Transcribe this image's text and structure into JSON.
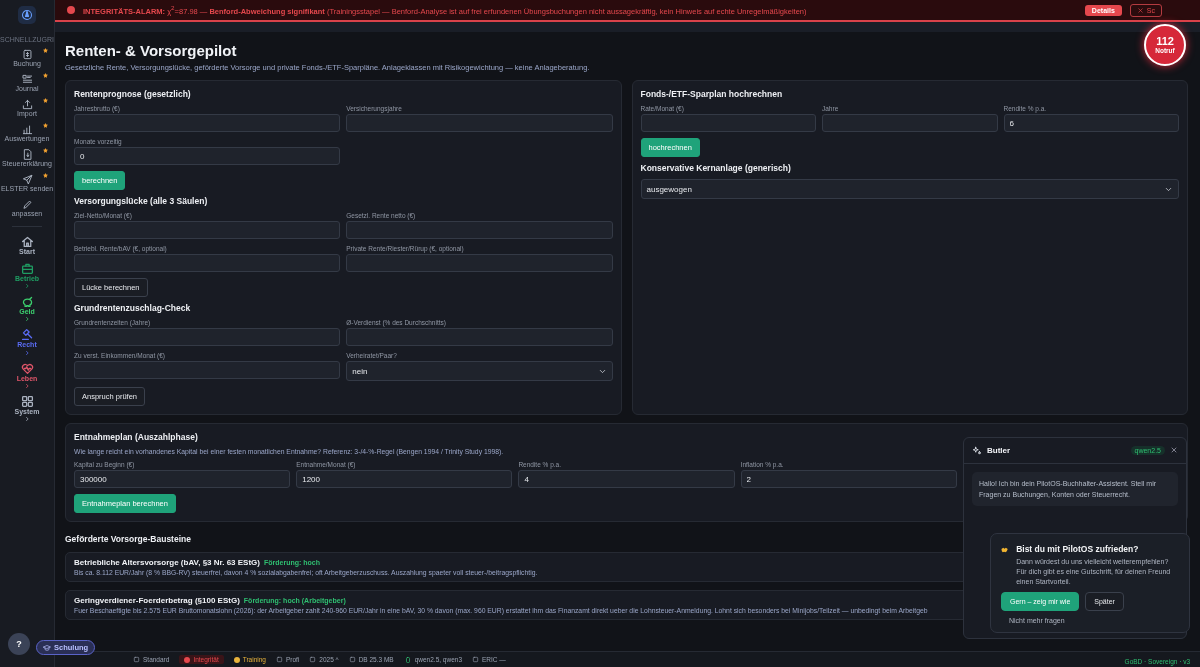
{
  "alarm": {
    "text": "**INTEGRITÄTS-ALARM:** χ$^{2}$=87.98 — **Benford-Abweichung signifikant** (Trainingsstapel — Benford-Analyse ist auf frei erfundenen Übungsbuchungen nicht aussagekräftig, kein Hinweis auf echte Unregelmäßigkeiten)",
    "details": "Details",
    "close": "Sc"
  },
  "emergency": {
    "number": "112",
    "label": "Notruf"
  },
  "sidebar": {
    "quick_label": "SCHNELLZUGRI",
    "quick_items": [
      {
        "label": "Buchung",
        "starred": true
      },
      {
        "label": "Journal",
        "starred": true
      },
      {
        "label": "Import",
        "starred": true
      },
      {
        "label": "Auswertungen",
        "starred": true
      },
      {
        "label": "Steuererklärung",
        "starred": true
      },
      {
        "label": "ELSTER senden",
        "starred": true
      },
      {
        "label": "anpassen",
        "starred": false
      }
    ],
    "sections": [
      {
        "label": "Start",
        "color": "#aab2c0",
        "expandable": false
      },
      {
        "label": "Betrieb",
        "color": "#1f9d63",
        "expandable": true
      },
      {
        "label": "Geld",
        "color": "#3ccf6e",
        "expandable": true
      },
      {
        "label": "Recht",
        "color": "#5a6cf5",
        "expandable": true
      },
      {
        "label": "Leben",
        "color": "#e0566a",
        "expandable": true
      },
      {
        "label": "System",
        "color": "#aab2c0",
        "expandable": true
      }
    ]
  },
  "page": {
    "title": "Renten- & Vorsorgepilot",
    "subtitle": "Gesetzliche Rente, Versorgungslücke, geförderte Vorsorge und private Fonds-/ETF-Sparpläne. Anlageklassen mit Risikogewichtung — keine Anlageberatung."
  },
  "left_card": [
    {
      "title": "Rentenprognose (gesetzlich)",
      "rows": [
        [
          {
            "label": "Jahresbrutto (€)",
            "kind": "input"
          },
          {
            "label": "Versicherungsjahre",
            "kind": "input"
          }
        ],
        [
          {
            "label": "Monate vorzeitig",
            "value": "0",
            "kind": "input"
          },
          {
            "kind": "spacer"
          }
        ]
      ],
      "button": {
        "label": "berechnen",
        "kind": "primary"
      }
    },
    {
      "title": "Versorgungslücke (alle 3 Säulen)",
      "rows": [
        [
          {
            "label": "Ziel-Netto/Monat (€)",
            "kind": "input"
          },
          {
            "label": "Gesetzl. Rente netto (€)",
            "kind": "input"
          }
        ],
        [
          {
            "label": "Betriebl. Rente/bAV (€, optional)",
            "kind": "input"
          },
          {
            "label": "Private Rente/Riester/Rürup (€, optional)",
            "kind": "input"
          }
        ]
      ],
      "button": {
        "label": "Lücke berechnen",
        "kind": "outline"
      }
    },
    {
      "title": "Grundrentenzuschlag-Check",
      "rows": [
        [
          {
            "label": "Grundrentenzeiten (Jahre)",
            "kind": "input"
          },
          {
            "label": "Ø-Verdienst (% des Durchschnitts)",
            "kind": "input"
          }
        ],
        [
          {
            "label": "Zu verst. Einkommen/Monat (€)",
            "kind": "input"
          },
          {
            "label": "Verheiratet/Paar?",
            "value": "nein",
            "kind": "select"
          }
        ]
      ],
      "button": {
        "label": "Anspruch prüfen",
        "kind": "outline"
      }
    }
  ],
  "right_card": [
    {
      "title": "Fonds-/ETF-Sparplan hochrechnen",
      "rows": [
        [
          {
            "label": "Rate/Monat (€)",
            "kind": "input"
          },
          {
            "label": "Jahre",
            "kind": "input"
          },
          {
            "label": "Rendite % p.a.",
            "value": "6",
            "kind": "input"
          }
        ]
      ],
      "button": {
        "label": "hochrechnen",
        "kind": "primary"
      }
    },
    {
      "title": "Konservative Kernanlage (generisch)",
      "rows": [
        [
          {
            "value": "ausgewogen",
            "kind": "select"
          }
        ]
      ]
    }
  ],
  "withdrawal": {
    "title": "Entnahmeplan (Auszahlphase)",
    "description": "Wie lange reicht ein vorhandenes Kapital bei einer festen monatlichen Entnahme? Referenz: 3-/4-%-Regel (Bengen 1994 / Trinity Study 1998).",
    "fields": [
      {
        "label": "Kapital zu Beginn (€)",
        "value": "300000",
        "kind": "input"
      },
      {
        "label": "Entnahme/Monat (€)",
        "value": "1200",
        "kind": "input"
      },
      {
        "label": "Rendite % p.a.",
        "value": "4",
        "kind": "input"
      },
      {
        "label": "Inflation % p.a.",
        "value": "2",
        "kind": "input"
      }
    ],
    "button": {
      "label": "Entnahmeplan berechnen",
      "kind": "primary"
    }
  },
  "modules": {
    "title": "Geförderte Vorsorge-Bausteine",
    "items": [
      {
        "title": "Betriebliche Altersvorsorge (bAV, §3 Nr. 63 EStG)",
        "badge": "Förderung: hoch",
        "text": "Bis ca. 8.112 EUR/Jahr (8 % BBG-RV) steuerfrei, davon 4 % sozialabgabenfrei; oft Arbeitgeberzuschuss. Auszahlung spaeter voll steuer-/beitragspflichtig."
      },
      {
        "title": "Geringverdiener-Foerderbetrag (§100 EStG)",
        "badge": "Förderung: hoch (Arbeitgeber)",
        "text": "Fuer Beschaeftigte bis 2.575 EUR Bruttomonatslohn (2026): der Arbeitgeber zahlt 240-960 EUR/Jahr in eine bAV, 30 % davon (max. 960 EUR) erstattet ihm das Finanzamt direkt ueber die Lohnsteuer-Anmeldung. Lohnt sich besonders bei Minijobs/Teilzeit — unbedingt beim Arbeitgeb"
      }
    ]
  },
  "butler": {
    "title": "Butler",
    "model": "qwen2.5",
    "message": "Hallo! Ich bin dein PilotOS-Buchhalter-Assistent. Stell mir Fragen zu Buchungen, Konten oder Steuerrecht."
  },
  "survey": {
    "title": "Bist du mit PilotOS zufrieden?",
    "text": "Dann würdest du uns vielleicht weiterempfehlen? Für dich gibt es eine Gutschrift, für deinen Freund einen Startvorteil.",
    "primary": "Gern – zeig mir wie",
    "secondary": "Später",
    "dismiss": "Nicht mehr fragen"
  },
  "help": {
    "label": "?",
    "training": "Schulung"
  },
  "status_bar": [
    {
      "kind": "text",
      "label": "Standard"
    },
    {
      "kind": "alert",
      "label": "Integrität"
    },
    {
      "kind": "warn",
      "label": "Training"
    },
    {
      "kind": "text",
      "label": "Profi"
    },
    {
      "kind": "text",
      "label": "2025 ^"
    },
    {
      "kind": "text",
      "label": "DB 25.3 MB"
    },
    {
      "kind": "ok",
      "label": "qwen2.5, qwen3"
    },
    {
      "kind": "text",
      "label": "ERIC —"
    }
  ],
  "version": "GoBD · Sovereign · v3"
}
